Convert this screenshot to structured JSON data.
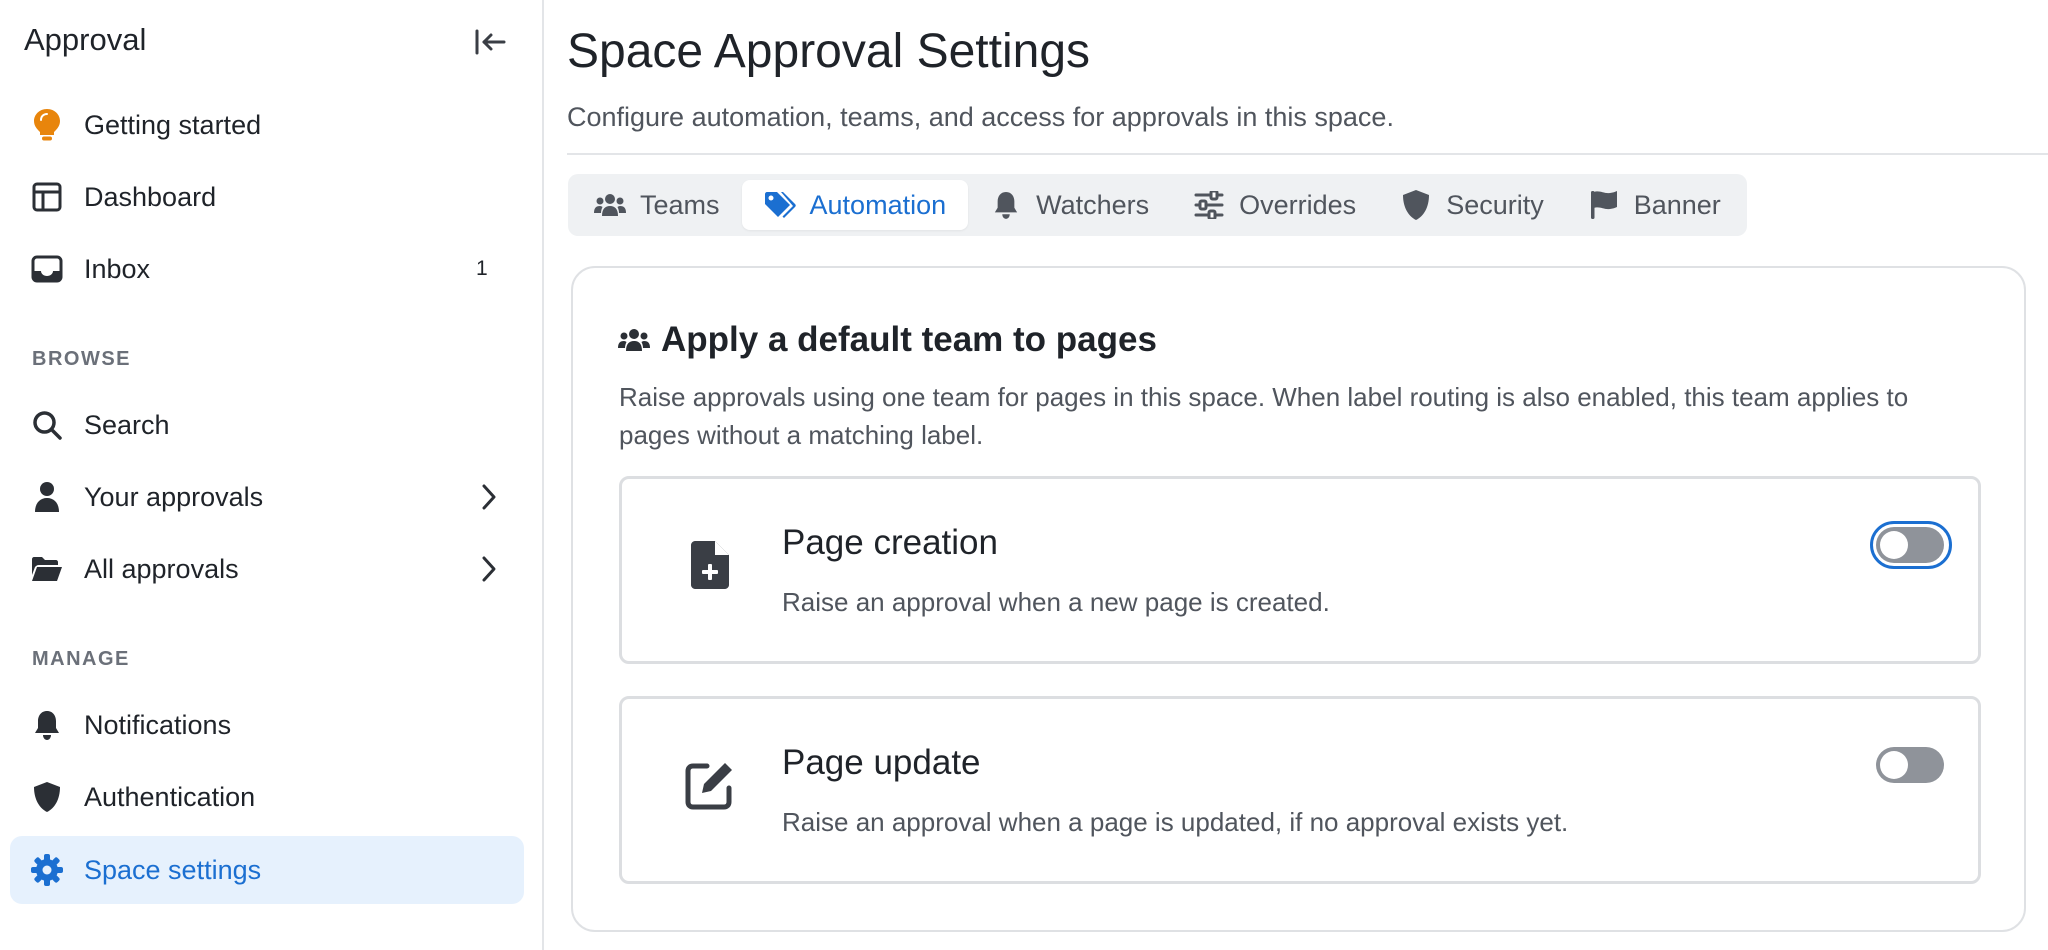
{
  "sidebar": {
    "title": "Approval",
    "primary_items": [
      {
        "label": "Getting started",
        "icon": "lightbulb-icon"
      },
      {
        "label": "Dashboard",
        "icon": "dashboard-icon"
      },
      {
        "label": "Inbox",
        "icon": "inbox-icon",
        "count": "1"
      }
    ],
    "browse_label": "BROWSE",
    "browse_items": [
      {
        "label": "Search",
        "icon": "search-icon"
      },
      {
        "label": "Your approvals",
        "icon": "user-icon"
      },
      {
        "label": "All approvals",
        "icon": "folder-open-icon"
      }
    ],
    "manage_label": "MANAGE",
    "manage_items": [
      {
        "label": "Notifications",
        "icon": "bell-icon"
      },
      {
        "label": "Authentication",
        "icon": "shield-icon"
      },
      {
        "label": "Space settings",
        "icon": "gear-icon",
        "active": true
      }
    ]
  },
  "main": {
    "title": "Space Approval Settings",
    "subtitle": "Configure automation, teams, and access for approvals in this space.",
    "tabs": [
      {
        "label": "Teams",
        "icon": "users-icon"
      },
      {
        "label": "Automation",
        "icon": "tags-icon",
        "active": true
      },
      {
        "label": "Watchers",
        "icon": "bell-icon"
      },
      {
        "label": "Overrides",
        "icon": "sliders-icon"
      },
      {
        "label": "Security",
        "icon": "shield-icon"
      },
      {
        "label": "Banner",
        "icon": "flag-icon"
      }
    ],
    "panel": {
      "title": "Apply a default team to pages",
      "description": "Raise approvals using one team for pages in this space. When label routing is also enabled, this team applies to pages without a matching label.",
      "cards": [
        {
          "title": "Page creation",
          "description": "Raise an approval when a new page is created.",
          "icon": "file-plus-icon",
          "enabled": false
        },
        {
          "title": "Page update",
          "description": "Raise an approval when a page is updated, if no approval exists yet.",
          "icon": "edit-icon",
          "enabled": false
        }
      ]
    }
  },
  "colors": {
    "accent": "#1b6fd1",
    "active_bg": "#e6f1fd",
    "lightbulb": "#e8850c",
    "toggle_off": "#8f939a"
  }
}
